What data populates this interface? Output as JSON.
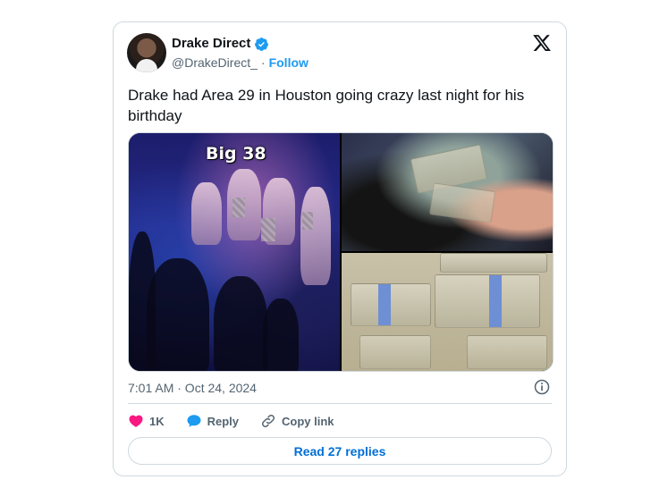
{
  "author": {
    "display_name": "Drake Direct",
    "handle": "@DrakeDirect_",
    "separator": "·",
    "follow_label": "Follow",
    "verified_icon": "verified-badge-icon",
    "avatar": "avatar"
  },
  "tweet": {
    "text": "Drake had Area 29 in Houston going crazy last night for his birthday",
    "media_caption": "Big 38",
    "timestamp": "7:01 AM · Oct 24, 2024"
  },
  "actions": {
    "likes_count": "1K",
    "reply_label": "Reply",
    "copy_link_label": "Copy link"
  },
  "read_replies_label": "Read 27 replies",
  "colors": {
    "accent": "#1d9bf0",
    "like": "#f91880",
    "text_secondary": "#536471",
    "border": "#cfd9de"
  }
}
